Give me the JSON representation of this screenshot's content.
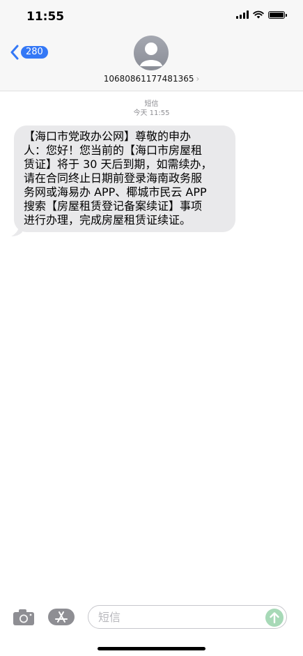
{
  "status": {
    "time": "11:55"
  },
  "nav": {
    "back_count": "280",
    "contact": "10680861177481365",
    "chevron": "›"
  },
  "conversation": {
    "meta_label": "短信",
    "meta_time": "今天 11:55",
    "messages": [
      {
        "lines": [
          "【海口市党政办公网】尊敬的申办",
          "人：您好！您当前的【海口市房屋租",
          "赁证】将于 30 天后到期，如需续办，",
          "请在合同终止日期前登录海南政务服",
          "务网或海易办 APP、椰城市民云 APP",
          "搜索【房屋租赁登记备案续证】事项",
          "进行办理，完成房屋租赁证续证。"
        ]
      }
    ]
  },
  "input": {
    "placeholder": "短信"
  },
  "colors": {
    "accent": "#3478f6",
    "bubble": "#e9e9eb",
    "send": "#a7d9b7"
  },
  "icons": [
    "back-chevron-icon",
    "avatar-person-icon",
    "camera-icon",
    "app-store-icon",
    "send-arrow-icon",
    "wifi-icon",
    "signal-icon",
    "battery-icon"
  ]
}
